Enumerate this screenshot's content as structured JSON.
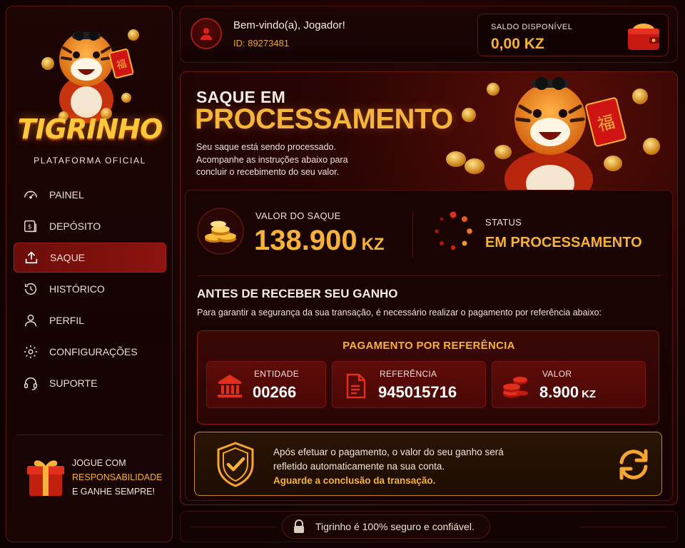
{
  "sidebar": {
    "logo_text": "TIGRINHO",
    "logo_subtitle": "PLATAFORMA OFICIAL",
    "items": [
      {
        "label": "PAINEL",
        "icon": "gauge-icon"
      },
      {
        "label": "DEPÓSITO",
        "icon": "deposit-icon"
      },
      {
        "label": "SAQUE",
        "icon": "upload-icon",
        "active": true
      },
      {
        "label": "HISTÓRICO",
        "icon": "history-icon"
      },
      {
        "label": "PERFIL",
        "icon": "user-icon"
      },
      {
        "label": "CONFIGURAÇÕES",
        "icon": "gear-icon"
      },
      {
        "label": "SUPORTE",
        "icon": "headset-icon"
      }
    ],
    "responsible": {
      "line1": "JOGUE COM",
      "line2": "RESPONSABILIDADE",
      "line3": "E GANHE SEMPRE!"
    }
  },
  "header": {
    "welcome": "Bem-vindo(a), Jogador!",
    "user_id": "ID: 89273481",
    "balance_label": "SALDO DISPONÍVEL",
    "balance_value": "0,00 KZ"
  },
  "hero": {
    "title_line1": "SAQUE EM",
    "title_line2": "PROCESSAMENTO",
    "desc_line1": "Seu saque está sendo processado.",
    "desc_line2": "Acompanhe as instruções abaixo para",
    "desc_line3": "concluir o recebimento do seu valor."
  },
  "withdrawal": {
    "value_label": "VALOR DO SAQUE",
    "value_amount": "138.900",
    "value_unit": "KZ",
    "status_label": "STATUS",
    "status_value": "EM PROCESSAMENTO"
  },
  "before": {
    "title": "ANTES DE RECEBER SEU GANHO",
    "desc": "Para garantir a segurança da sua transação, é necessário realizar o pagamento por referência abaixo:"
  },
  "reference": {
    "title": "PAGAMENTO POR REFERÊNCIA",
    "entity_label": "ENTIDADE",
    "entity_value": "00266",
    "ref_label": "REFERÊNCIA",
    "ref_value": "945015716",
    "amount_label": "VALOR",
    "amount_value": "8.900",
    "amount_unit": "KZ"
  },
  "notice": {
    "line1": "Após efetuar o pagamento, o valor do seu ganho será",
    "line2": "refletido automaticamente na sua conta.",
    "highlight": "Aguarde a conclusão da transação."
  },
  "footer": {
    "secure_text": "Tigrinho é 100% seguro e confiável."
  },
  "colors": {
    "accent_gold": "#f6b23a",
    "accent_red": "#8c1410",
    "background": "#150303"
  }
}
